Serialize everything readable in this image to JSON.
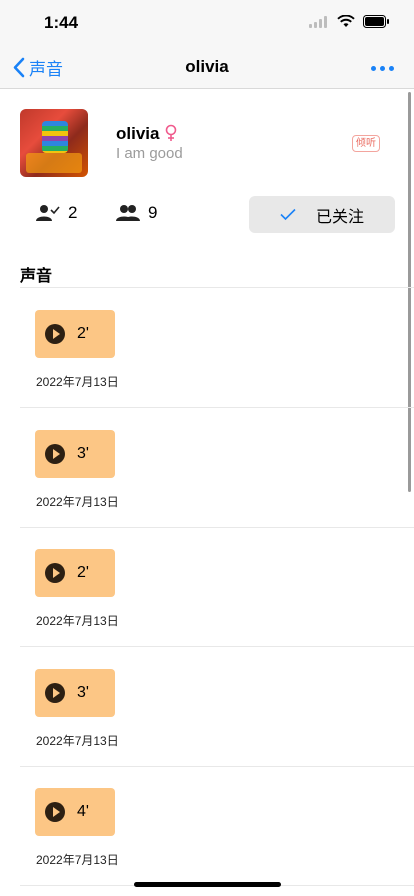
{
  "status_bar": {
    "time": "1:44"
  },
  "nav": {
    "back_label": "声音",
    "title": "olivia"
  },
  "profile": {
    "name": "olivia",
    "status": "I am good",
    "badge": "倾听",
    "following_count": "2",
    "followers_count": "9",
    "follow_button_label": "已关注"
  },
  "section": {
    "title": "声音"
  },
  "voices": [
    {
      "duration": "2'",
      "date": "2022年7月13日"
    },
    {
      "duration": "3'",
      "date": "2022年7月13日"
    },
    {
      "duration": "2'",
      "date": "2022年7月13日"
    },
    {
      "duration": "3'",
      "date": "2022年7月13日"
    },
    {
      "duration": "4'",
      "date": "2022年7月13日"
    }
  ],
  "colors": {
    "accent": "#1a82f7",
    "voice_bubble": "#fcc685",
    "badge": "#ea6b60"
  }
}
